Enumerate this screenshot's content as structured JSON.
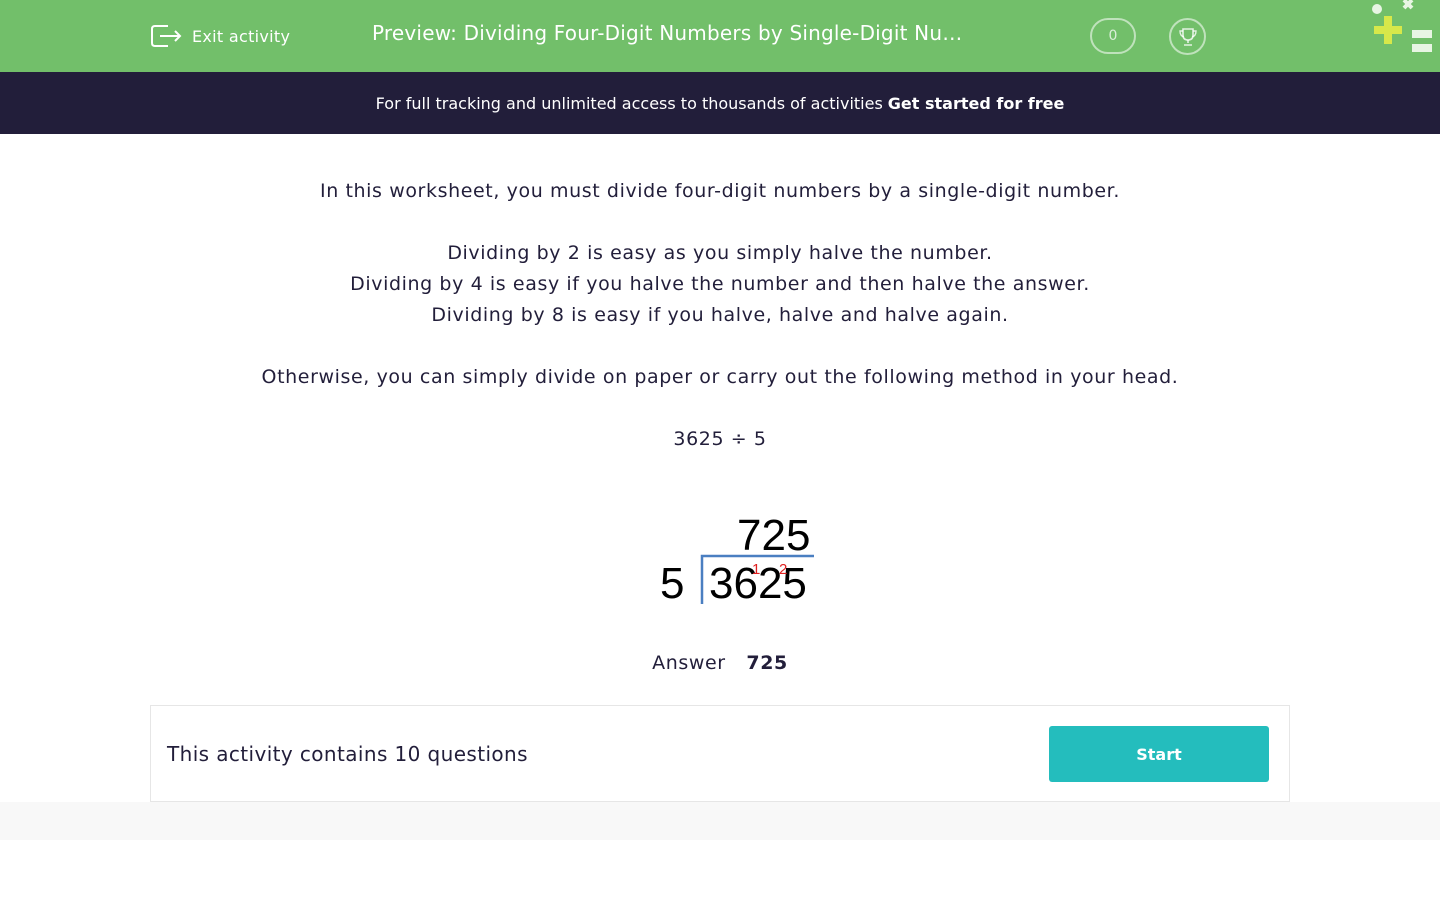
{
  "header": {
    "exit_label": "Exit activity",
    "title": "Preview: Dividing Four-Digit Numbers by Single-Digit Numbers",
    "score": "0",
    "bg_color": "#72bf6a"
  },
  "promo": {
    "text": "For full tracking and unlimited access to thousands of activities",
    "cta": "Get started for free",
    "bg_color": "#221e3a"
  },
  "intro": {
    "line1": "In this worksheet, you must divide four-digit numbers by a single-digit number.",
    "line2": "Dividing by 2 is easy as you simply halve the number.",
    "line3": "Dividing by 4 is easy if you halve the number and then halve the answer.",
    "line4": "Dividing by 8 is easy if you halve, halve and halve again.",
    "line5": "Otherwise, you can simply divide on paper or carry out the following method in your head.",
    "equation": "3625 ÷ 5"
  },
  "division": {
    "quotient": "725",
    "divisor": "5",
    "dividend": "3625",
    "carry1": "1",
    "carry2": "2"
  },
  "answer": {
    "label": "Answer",
    "value": "725"
  },
  "activity": {
    "count_text": "This activity contains 10 questions",
    "start_label": "Start",
    "button_color": "#24bdbd"
  }
}
